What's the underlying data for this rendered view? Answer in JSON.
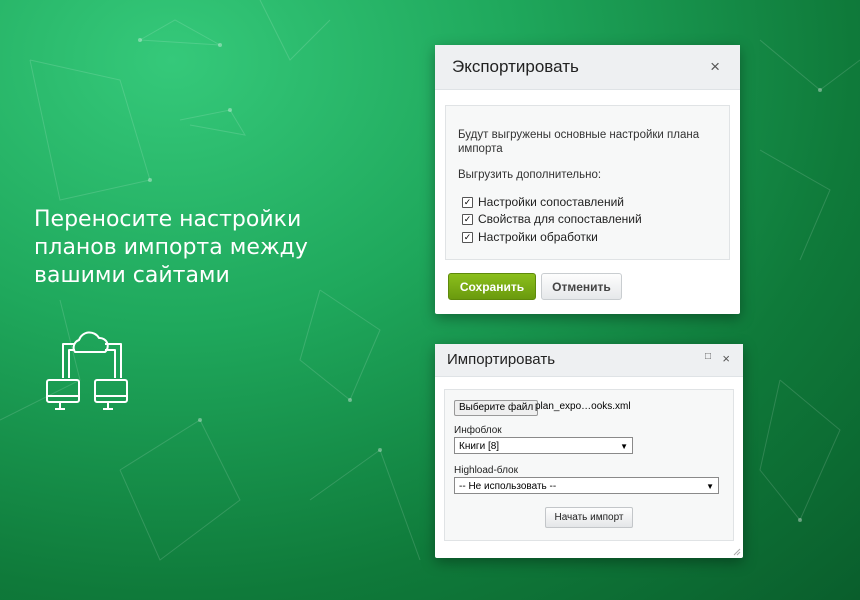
{
  "headline": [
    "Переносите настройки",
    "планов импорта между",
    "вашими сайтами"
  ],
  "export_dialog": {
    "title": "Экспортировать",
    "close_icon": "×",
    "description_lines": [
      "Будут выгружены основные настройки плана",
      "импорта"
    ],
    "extra_label": "Выгрузить дополнительно:",
    "options": [
      {
        "label": "Настройки сопоставлений",
        "checked": true
      },
      {
        "label": "Свойства для сопоставлений",
        "checked": true
      },
      {
        "label": "Настройки обработки",
        "checked": true
      }
    ],
    "save_label": "Сохранить",
    "cancel_label": "Отменить"
  },
  "import_dialog": {
    "title": "Импортировать",
    "maximize_icon": "□",
    "close_icon": "×",
    "file_button_label": "Выберите файл",
    "file_name": "plan_expo…ooks.xml",
    "iblock_label": "Инфоблок",
    "iblock_value": "Книги [8]",
    "highload_label": "Highload-блок",
    "highload_value": "-- Не использовать --",
    "import_button_label": "Начать импорт"
  },
  "colors": {
    "bg_green": "#1fa85c",
    "save_green": "#7aad14"
  },
  "icons": [
    "cloud-computers-icon",
    "close-icon",
    "maximize-icon",
    "checkbox-checked-icon",
    "dropdown-arrow-icon",
    "resize-grip-icon"
  ]
}
